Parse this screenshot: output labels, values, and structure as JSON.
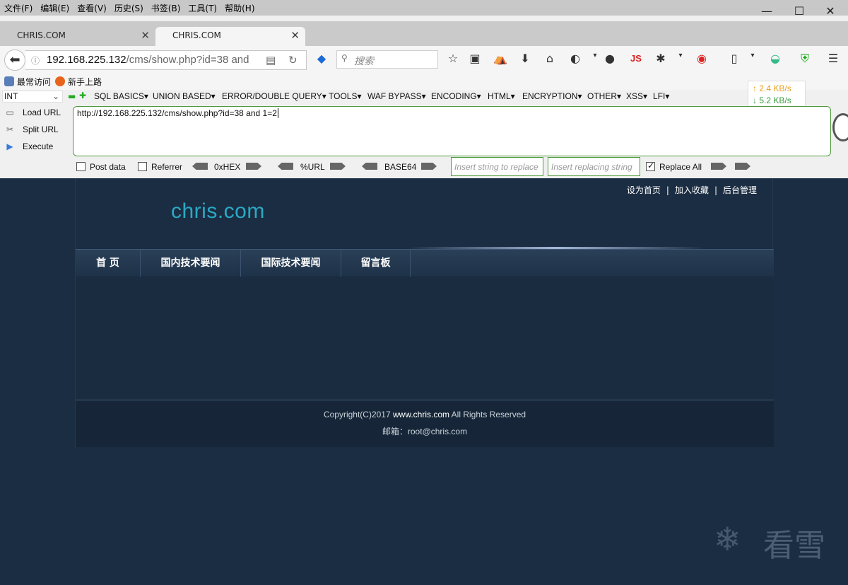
{
  "menubar": {
    "items": [
      "文件(F)",
      "编辑(E)",
      "查看(V)",
      "历史(S)",
      "书签(B)",
      "工具(T)",
      "帮助(H)"
    ]
  },
  "window_controls": {
    "minimize": "—",
    "maximize": "☐",
    "close": "✕"
  },
  "tabs": [
    {
      "label": "CHRIS.COM",
      "active": false
    },
    {
      "label": "CHRIS.COM",
      "active": true
    }
  ],
  "navbar": {
    "url_host": "192.168.225.132",
    "url_path": "/cms/show.php?id=38 and",
    "search_placeholder": "搜索",
    "js_label": "JS"
  },
  "bookmarks": [
    {
      "label": "最常访问",
      "icon": "bookmark-icon"
    },
    {
      "label": "新手上路",
      "icon": "firefox-icon"
    }
  ],
  "hackbar": {
    "mode_select": "INT",
    "menus": [
      "SQL BASICS▾",
      "UNION BASED▾",
      "ERROR/DOUBLE QUERY▾",
      "TOOLS▾",
      "WAF BYPASS▾",
      "ENCODING▾",
      "HTML▾",
      "ENCRYPTION▾",
      "OTHER▾",
      "XSS▾",
      "LFI▾"
    ],
    "speed_up": "↑ 2.4 KB/s",
    "speed_down": "↓ 5.2 KB/s",
    "load_url": "Load URL",
    "split_url": "Split URL",
    "execute": "Execute",
    "url_text": "http://192.168.225.132/cms/show.php?id=38 and 1=2",
    "post_data_label": "Post data",
    "referrer_label": "Referrer",
    "hex_label": "0xHEX",
    "url_enc_label": "%URL",
    "base64_label": "BASE64",
    "replace_from_placeholder": "Insert string to replace",
    "replace_to_placeholder": "Insert replacing string",
    "replace_all_label": "Replace All",
    "replace_all_checked": true
  },
  "site": {
    "toplinks": [
      "设为首页",
      "|",
      "加入收藏",
      "|",
      "后台管理"
    ],
    "logo": "chris.com",
    "nav": [
      "首 页",
      "国内技术要闻",
      "国际技术要闻",
      "留言板"
    ],
    "footer_prefix": "Copyright(C)2017 ",
    "footer_domain": "www.chris.com",
    "footer_suffix": " All Rights Reserved",
    "footer_email": "邮箱：root@chris.com"
  },
  "watermark": {
    "text": "看雪"
  },
  "colors": {
    "accent": "#2aa9c5",
    "page_bg": "#1b2d42",
    "hackbar_border": "#4c9a3a"
  }
}
